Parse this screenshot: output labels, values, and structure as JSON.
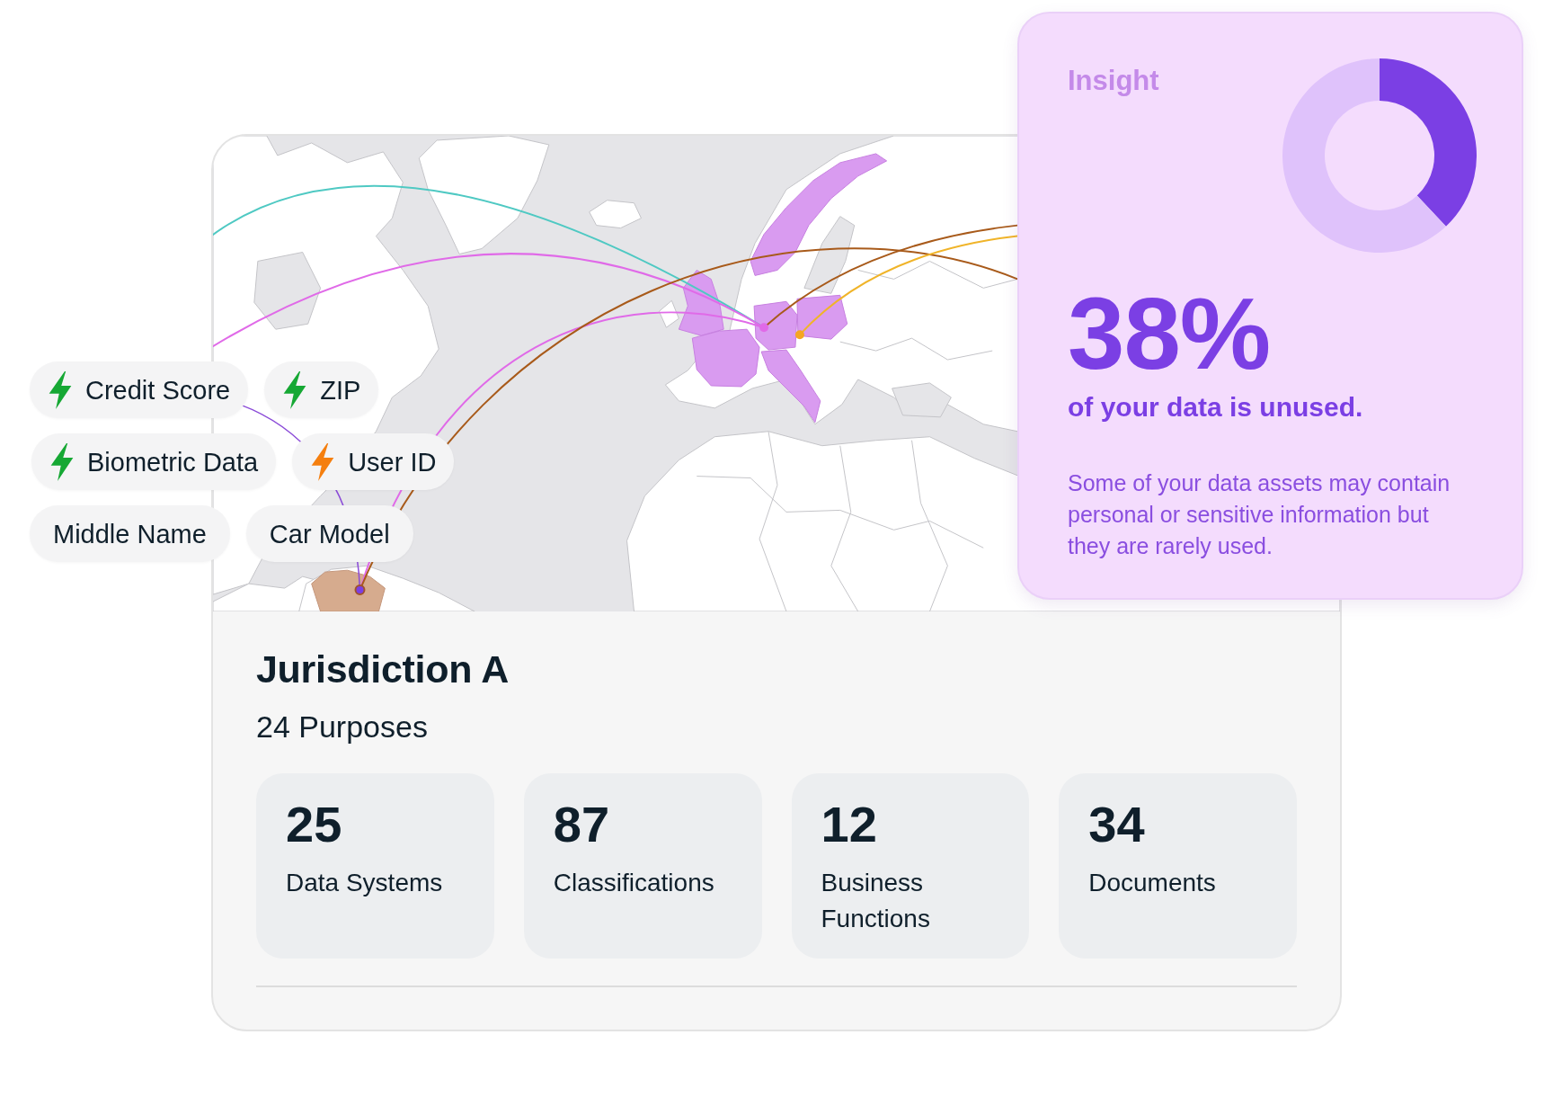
{
  "tag_rows": [
    {
      "tags": [
        {
          "label": "Credit Score",
          "kind": "flagged",
          "color": "#16a834"
        },
        {
          "label": "ZIP",
          "kind": "flagged",
          "color": "#16a834"
        }
      ]
    },
    {
      "tags": [
        {
          "label": "Biometric Data",
          "kind": "flagged",
          "color": "#16a834"
        },
        {
          "label": "User ID",
          "kind": "flagged",
          "color": "#f57f0f"
        }
      ]
    },
    {
      "tags": [
        {
          "label": "Middle Name",
          "kind": "plain"
        },
        {
          "label": "Car Model",
          "kind": "plain"
        }
      ]
    }
  ],
  "jurisdiction": {
    "title": "Jurisdiction A",
    "purposes": "24 Purposes",
    "stats": [
      {
        "value": "25",
        "label": "Data Systems"
      },
      {
        "value": "87",
        "label": "Classifications"
      },
      {
        "value": "12",
        "label": "Business Functions"
      },
      {
        "value": "34",
        "label": "Documents"
      }
    ]
  },
  "insight": {
    "heading": "Insight",
    "chart_data": {
      "type": "donut",
      "values": [
        38,
        62
      ]
    },
    "figure": "38%",
    "caption": "of your data is unused.",
    "description": "Some of your data assets may contain personal or sensitive information but they are rarely used."
  }
}
